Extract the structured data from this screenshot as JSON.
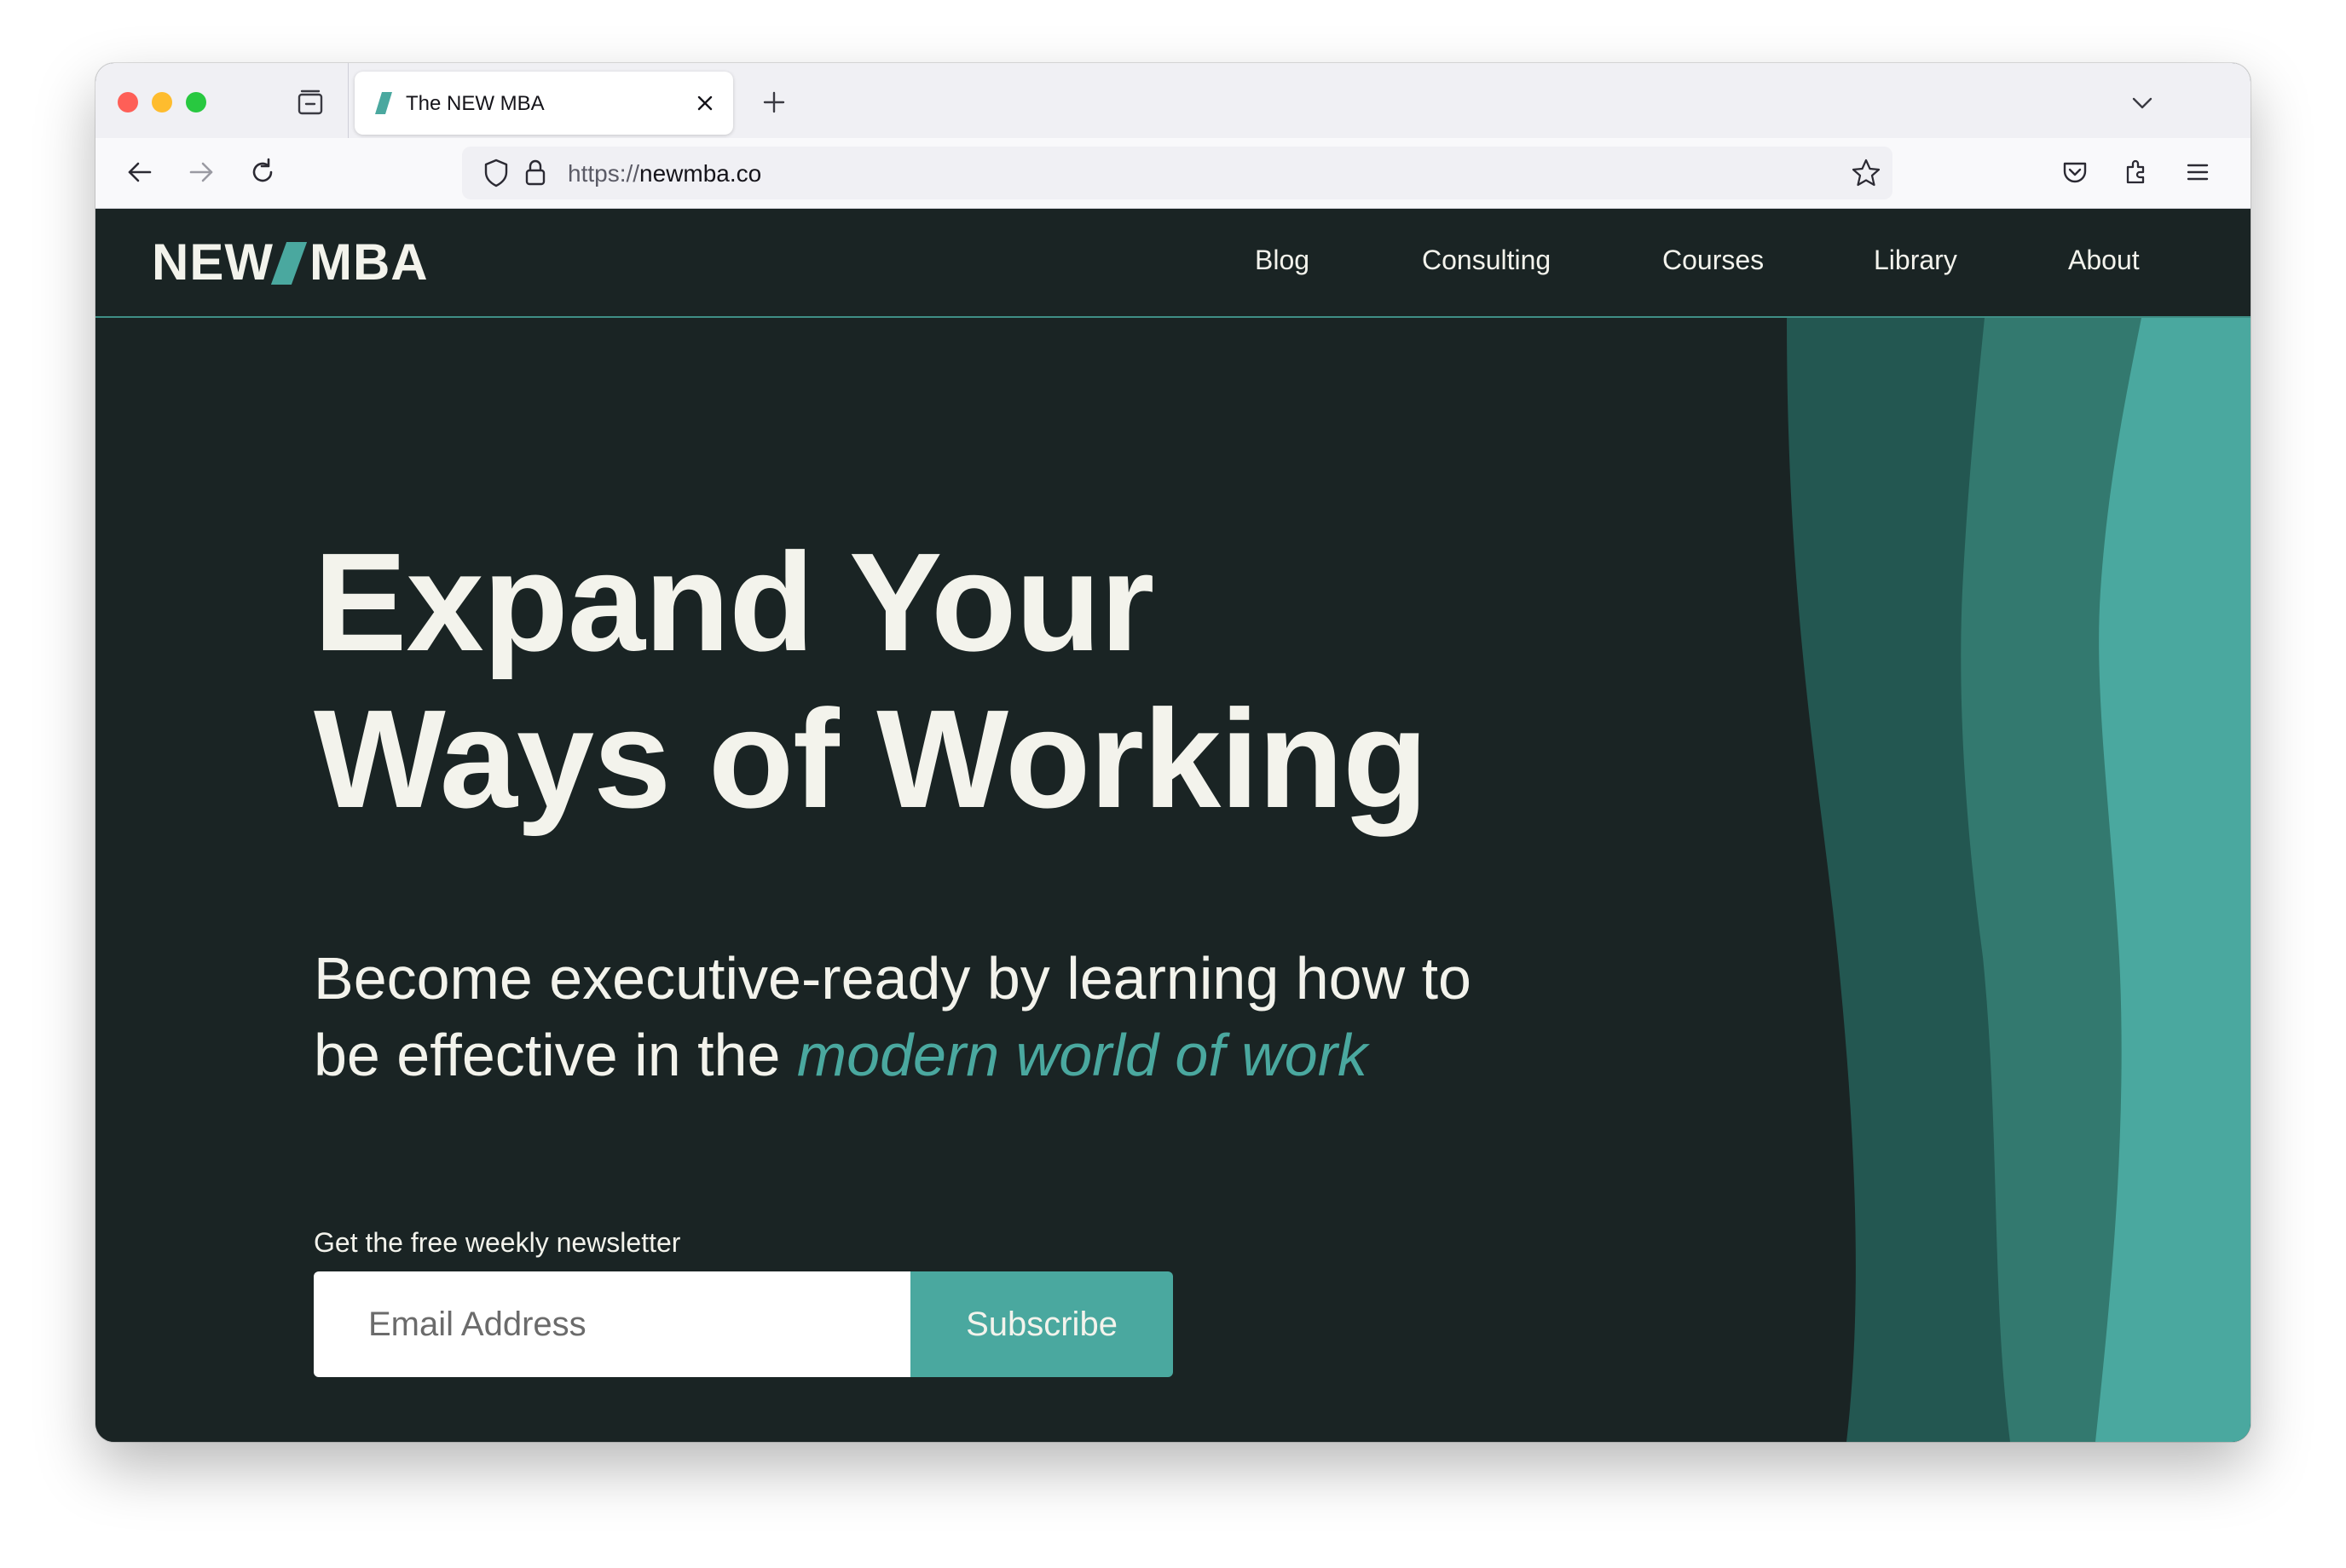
{
  "browser": {
    "tab": {
      "title": "The NEW MBA",
      "favicon": "newmba-favicon-icon"
    },
    "url": {
      "scheme": "https://",
      "host": "newmba.co"
    },
    "icons": [
      "tabs-icon",
      "close-icon",
      "new-tab-icon",
      "tab-list-icon",
      "back-icon",
      "forward-icon",
      "reload-icon",
      "shield-icon",
      "lock-icon",
      "bookmark-star-icon",
      "pocket-icon",
      "extensions-icon",
      "menu-icon"
    ]
  },
  "site": {
    "logo": {
      "left": "NEW",
      "right": "MBA"
    },
    "nav": [
      {
        "label": "Blog"
      },
      {
        "label": "Consulting"
      },
      {
        "label": "Courses"
      },
      {
        "label": "Library"
      },
      {
        "label": "About"
      }
    ],
    "hero": {
      "title_line1": "Expand Your",
      "title_line2": "Ways of Working",
      "subtitle_line1": "Become executive-ready by learning how to",
      "subtitle_line2_start": "be effective in the ",
      "subtitle_line2_accent": "modern world of work"
    },
    "newsletter": {
      "label": "Get the free weekly newsletter",
      "email_placeholder": "Email Address",
      "subscribe_label": "Subscribe"
    }
  },
  "colors": {
    "page_bg": "#1a2424",
    "text": "#f3f3ec",
    "accent": "#4aa89f",
    "wave_dark": "#235751",
    "wave_mid": "#33796f",
    "wave_light": "#4aa89f"
  }
}
